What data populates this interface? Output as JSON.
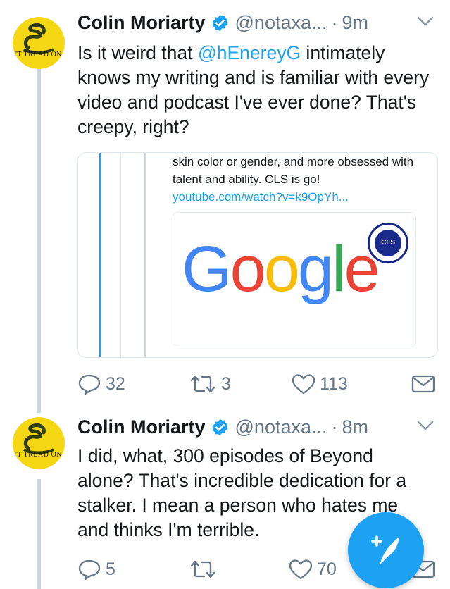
{
  "tweets": [
    {
      "author_name": "Colin Moriarty",
      "handle": "@notaxa...",
      "separator": "·",
      "time": "9m",
      "avatar_text": "'T TREAD ON",
      "text_segments": [
        "Is it weird that ",
        "@hEnereyG",
        " intimately knows my writing and is familiar with every video and podcast I've ever done? That's creepy, right?"
      ],
      "card": {
        "text": "skin color or gender, and more obsessed with talent and ability. CLS is go! ",
        "link": "youtube.com/watch?v=k9OpYh...",
        "image_logo": "Google",
        "badge_text": "CLS"
      },
      "actions": {
        "replies": "32",
        "retweets": "3",
        "likes": "113"
      }
    },
    {
      "author_name": "Colin Moriarty",
      "handle": "@notaxa...",
      "separator": "·",
      "time": "8m",
      "avatar_text": "'T TREAD ON",
      "text": "I did, what, 300 episodes of Beyond alone? That's incredible dedication for a stalker. I mean a person who hates me and thinks I'm terrible.",
      "actions": {
        "replies": "5",
        "retweets": "",
        "likes": "70"
      }
    }
  ],
  "colors": {
    "accent": "#1da1f2",
    "text": "#14171a",
    "muted": "#657786",
    "thread_line": "#ccd6dd",
    "avatar_bg": "#f6d714"
  },
  "icons": [
    "verified-badge-icon",
    "chevron-down-icon",
    "reply-icon",
    "retweet-icon",
    "like-icon",
    "direct-message-icon",
    "compose-tweet-icon"
  ]
}
